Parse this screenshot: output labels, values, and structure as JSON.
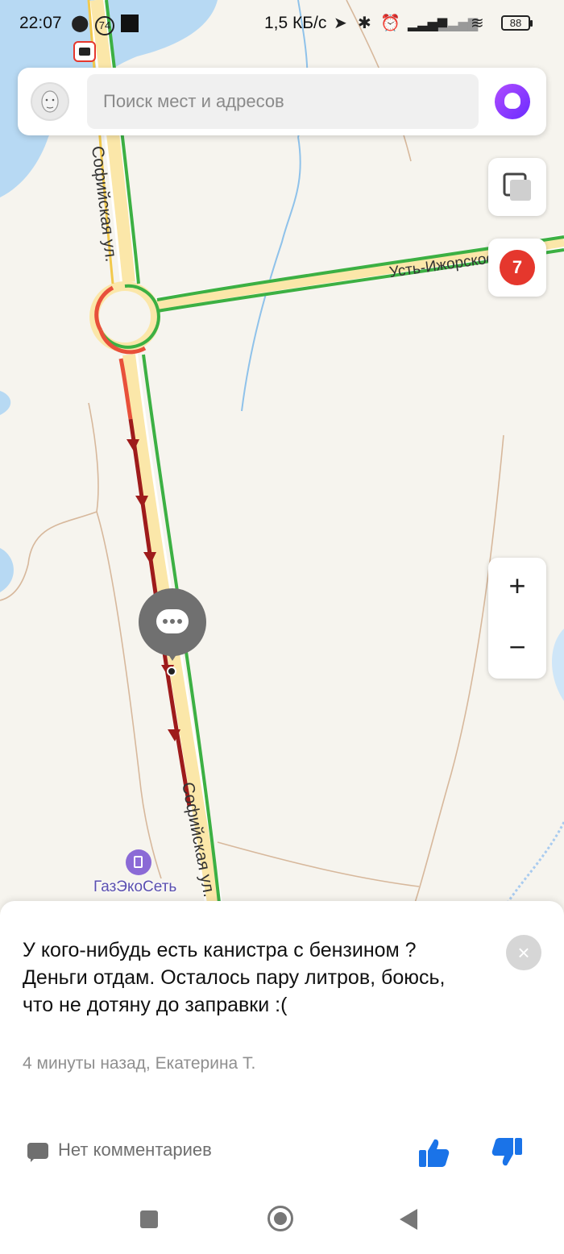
{
  "status_bar": {
    "time": "22:07",
    "network_speed": "1,5 КБ/с",
    "battery": "88",
    "notification_badge": "74"
  },
  "search": {
    "placeholder": "Поиск мест и адресов"
  },
  "map": {
    "streets": [
      "Софийская ул.",
      "Усть-Ижорское ш.",
      "Софийская ул."
    ],
    "traffic_level": "7",
    "poi_name": "ГазЭкоСеть",
    "zoom_in": "+",
    "zoom_out": "−"
  },
  "post": {
    "message": "У кого-нибудь есть канистра с бензином ? Деньги отдам. Осталось пару литров, боюсь, что не дотяну до заправки :(",
    "meta": "4 минуты назад, Екатерина Т.",
    "comments": "Нет комментариев",
    "close": "×"
  },
  "colors": {
    "traffic_free": "#3cb043",
    "traffic_heavy": "#e8503a",
    "traffic_jam": "#9e1b1b",
    "alice": "#8a3cff",
    "like": "#1a73e8"
  }
}
